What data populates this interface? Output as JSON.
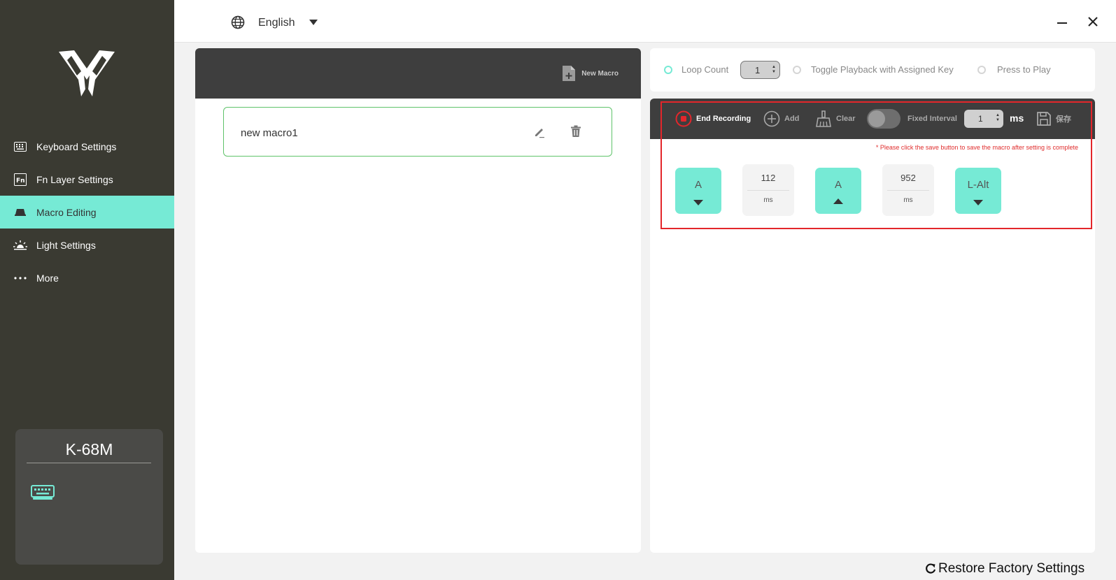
{
  "sidebar": {
    "items": [
      {
        "label": "Keyboard Settings",
        "icon": "keyboard-icon"
      },
      {
        "label": "Fn Layer Settings",
        "icon": "fn-icon"
      },
      {
        "label": "Macro Editing",
        "icon": "macro-icon",
        "active": true
      },
      {
        "label": "Light Settings",
        "icon": "light-icon"
      },
      {
        "label": "More",
        "icon": "more-icon"
      }
    ],
    "device": {
      "name": "K-68M",
      "icon": "keyboard-device-icon"
    }
  },
  "topbar": {
    "language": "English",
    "globe_icon": "globe-icon"
  },
  "macro_list": {
    "new_macro_label": "New Macro",
    "items": [
      {
        "name": "new macro1"
      }
    ]
  },
  "playback": {
    "loop_count_label": "Loop Count",
    "loop_count_value": "1",
    "toggle_label": "Toggle Playback with Assigned Key",
    "press_label": "Press to Play",
    "selected": "loop_count"
  },
  "editor": {
    "end_recording_label": "End Recording",
    "add_label": "Add",
    "clear_label": "Clear",
    "fixed_interval_label": "Fixed Interval",
    "fixed_interval_on": false,
    "interval_value": "1",
    "interval_unit": "ms",
    "save_label": "保存",
    "warning": "* Please click the save button to save the macro after setting is complete",
    "steps": [
      {
        "type": "key",
        "label": "A",
        "direction": "down"
      },
      {
        "type": "delay",
        "value": "112",
        "unit": "ms"
      },
      {
        "type": "key",
        "label": "A",
        "direction": "up"
      },
      {
        "type": "delay",
        "value": "952",
        "unit": "ms"
      },
      {
        "type": "key",
        "label": "L-Alt",
        "direction": "down"
      }
    ]
  },
  "footer": {
    "restore_label": "Restore Factory Settings"
  },
  "colors": {
    "sidebar_bg": "#3a3a32",
    "accent": "#76ead5",
    "toolbar_bg": "#3e3e3e",
    "highlight": "#e3262b",
    "warning": "#e02d2d"
  }
}
